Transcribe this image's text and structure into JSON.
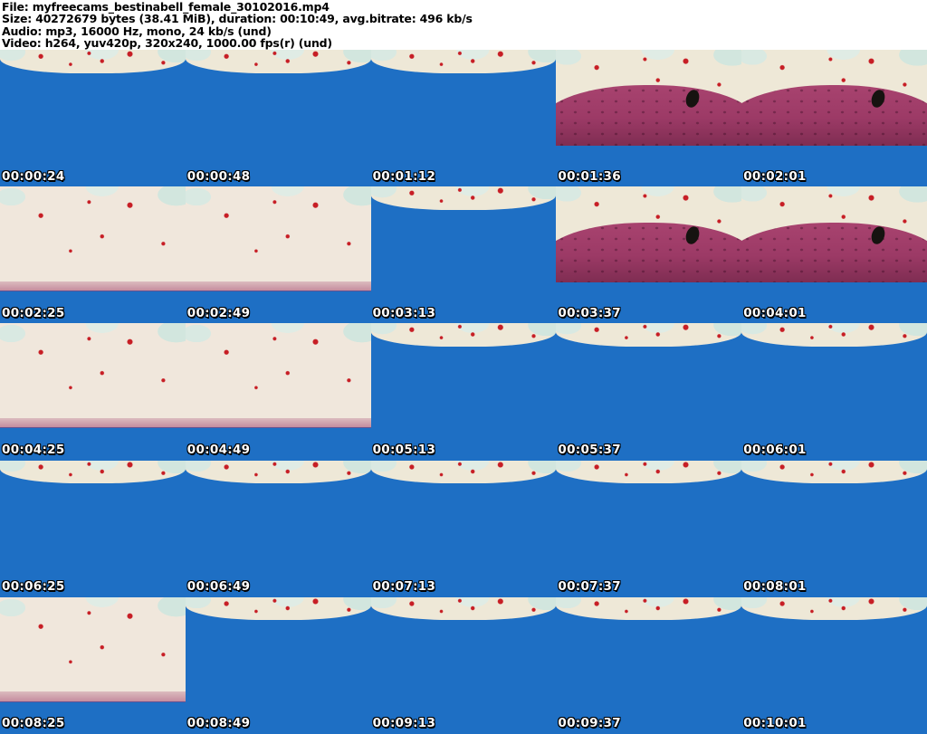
{
  "header": {
    "lines": [
      "File: myfreecams_bestinabell_female_30102016.mp4",
      "Size: 40272679 bytes (38.41 MiB), duration: 00:10:49, avg.bitrate: 496 kb/s",
      "Audio: mp3, 16000 Hz, mono, 24 kb/s (und)",
      "Video: h264, yuv420p, 320x240, 1000.00 fps(r) (und)"
    ]
  },
  "grid": {
    "columns": 5,
    "rows": 5,
    "thumbnails": [
      {
        "timestamp": "00:00:24",
        "variant": "blue"
      },
      {
        "timestamp": "00:00:48",
        "variant": "blue"
      },
      {
        "timestamp": "00:01:12",
        "variant": "blue"
      },
      {
        "timestamp": "00:01:36",
        "variant": "room"
      },
      {
        "timestamp": "00:02:01",
        "variant": "room"
      },
      {
        "timestamp": "00:02:25",
        "variant": "pale"
      },
      {
        "timestamp": "00:02:49",
        "variant": "pale"
      },
      {
        "timestamp": "00:03:13",
        "variant": "blue"
      },
      {
        "timestamp": "00:03:37",
        "variant": "room"
      },
      {
        "timestamp": "00:04:01",
        "variant": "room"
      },
      {
        "timestamp": "00:04:25",
        "variant": "pale"
      },
      {
        "timestamp": "00:04:49",
        "variant": "pale"
      },
      {
        "timestamp": "00:05:13",
        "variant": "blue"
      },
      {
        "timestamp": "00:05:37",
        "variant": "blue"
      },
      {
        "timestamp": "00:06:01",
        "variant": "blue"
      },
      {
        "timestamp": "00:06:25",
        "variant": "blue"
      },
      {
        "timestamp": "00:06:49",
        "variant": "blue"
      },
      {
        "timestamp": "00:07:13",
        "variant": "blue"
      },
      {
        "timestamp": "00:07:37",
        "variant": "blue"
      },
      {
        "timestamp": "00:08:01",
        "variant": "blue"
      },
      {
        "timestamp": "00:08:25",
        "variant": "pale"
      },
      {
        "timestamp": "00:08:49",
        "variant": "blue"
      },
      {
        "timestamp": "00:09:13",
        "variant": "blue"
      },
      {
        "timestamp": "00:09:37",
        "variant": "blue"
      },
      {
        "timestamp": "00:10:01",
        "variant": "blue"
      }
    ]
  },
  "colors": {
    "floor_blue": "#1e6fc4",
    "couch_magenta": "#9c3a66",
    "wall_cream": "#eee8d7",
    "splatter_red": "#c71e25",
    "timestamp_text": "#ffffff",
    "header_text": "#000000",
    "header_background": "#ffffff"
  }
}
